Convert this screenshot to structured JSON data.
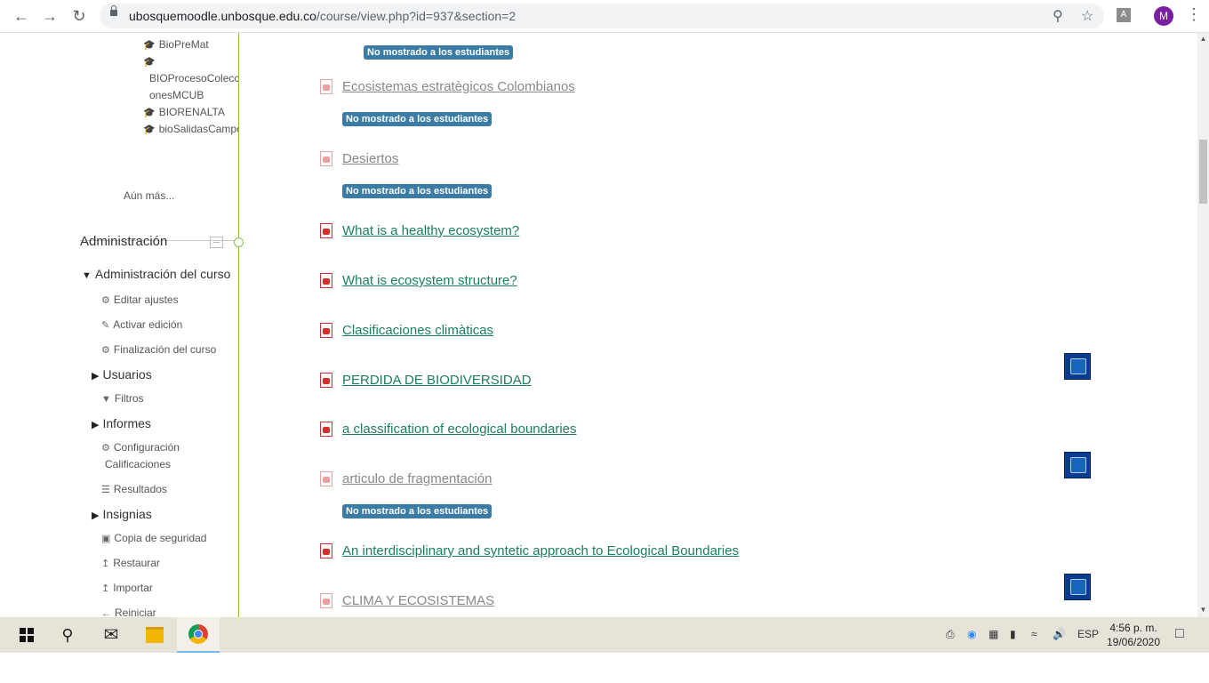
{
  "browser": {
    "url_host": "ubosquemoodle.unbosque.edu.co",
    "url_path": "/course/view.php?id=937&section=2",
    "avatar_letter": "M",
    "pdf_ext_label": "A"
  },
  "sidebar": {
    "courses": [
      {
        "label": "BioPreMat"
      },
      {
        "label": "BIOProcesoColecci"
      },
      {
        "label": "onesMCUB"
      },
      {
        "label": "BIORENALTA"
      },
      {
        "label": "bioSalidasCampo"
      }
    ],
    "more_label": "Aún más...",
    "admin_title": "Administración",
    "course_admin": "Administración del curso",
    "items": {
      "edit_settings": "Editar ajustes",
      "activate_edit": "Activar edición",
      "course_completion": "Finalización del curso",
      "users": "Usuarios",
      "filters": "Filtros",
      "reports": "Informes",
      "grades_config_1": "Configuración",
      "grades_config_2": "Calificaciones",
      "results": "Resultados",
      "badges": "Insignias",
      "backup": "Copia de seguridad",
      "restore": "Restaurar",
      "import": "Importar",
      "reset": "Reiniciar"
    }
  },
  "main": {
    "hidden_badge": "No mostrado a los estudiantes",
    "activities": [
      {
        "title": "Ecosistemas estratègicos Colombianos",
        "hidden": true
      },
      {
        "title": "Desiertos",
        "hidden": true
      },
      {
        "title": "What is a healthy ecosystem?",
        "hidden": false
      },
      {
        "title": "What is ecosystem structure?",
        "hidden": false
      },
      {
        "title": "Clasificaciones climàticas",
        "hidden": false
      },
      {
        "title": "PERDIDA DE BIODIVERSIDAD",
        "hidden": false
      },
      {
        "title": "a classification of ecological boundaries",
        "hidden": false
      },
      {
        "title": "articulo de fragmentación",
        "hidden": true
      },
      {
        "title": "An interdisciplinary and syntetic approach to Ecological Boundaries",
        "hidden": false
      },
      {
        "title": "CLIMA Y ECOSISTEMAS",
        "hidden": true
      }
    ]
  },
  "taskbar": {
    "language": "ESP",
    "time": "4:56 p. m.",
    "date": "19/06/2020"
  },
  "colors": {
    "link": "#1b7f5a",
    "badge": "#3a7ca5",
    "sidebar_line": "#8bc34a",
    "checkbox": "#0a3d91"
  }
}
